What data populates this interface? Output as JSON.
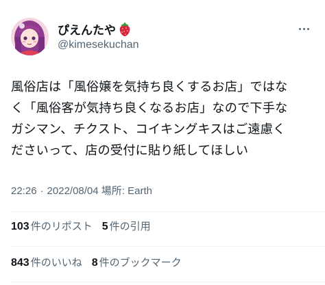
{
  "user": {
    "display_name": "ぴえんたや",
    "display_name_emoji_icon": "strawberry-icon",
    "handle": "@kimesekuchan",
    "avatar_icon": "avatar-illustration"
  },
  "more_icon": "more-options-icon",
  "tweet": {
    "lines": [
      "風俗店は「風俗嬢を気持ち良くするお店」ではな",
      "く「風俗客が気持ち良くなるお店」なので下手な",
      "ガシマン、チクスト、コイキングキスはご遠慮く",
      "ださいって、店の受付に貼り紙してほしい"
    ]
  },
  "meta": {
    "time": "22:26",
    "separator": "·",
    "date": "2022/08/04",
    "location": "場所: Earth"
  },
  "stats": {
    "reposts_count": "103",
    "reposts_label": "件のリポスト",
    "quotes_count": "5",
    "quotes_label": "件の引用",
    "likes_count": "843",
    "likes_label": "件のいいね",
    "bookmarks_count": "8",
    "bookmarks_label": "件のブックマーク"
  },
  "colors": {
    "text_primary": "#0f1419",
    "text_secondary": "#536471",
    "divider": "#eff3f4",
    "strawberry": "#d7263d"
  }
}
